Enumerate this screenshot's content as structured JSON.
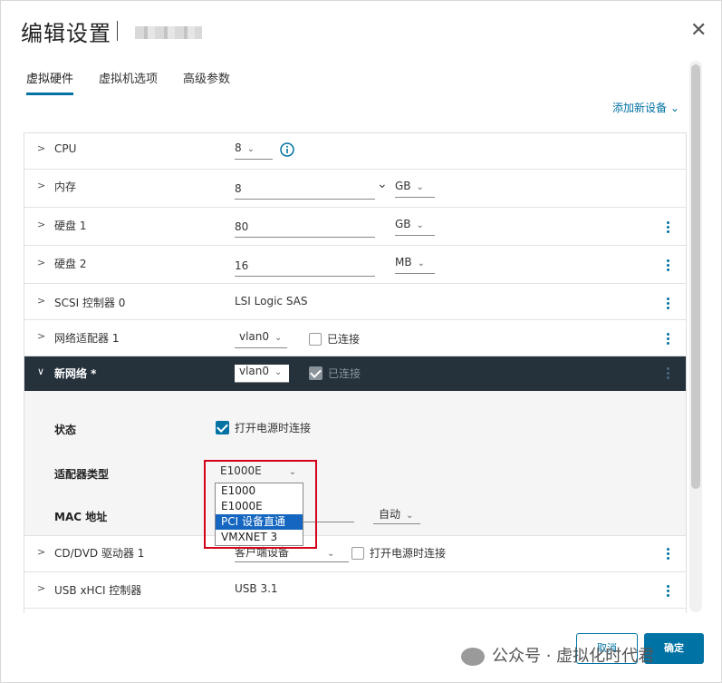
{
  "dialog": {
    "title": "编辑设置",
    "close": "✕"
  },
  "tabs": [
    "虚拟硬件",
    "虚拟机选项",
    "高级参数"
  ],
  "add_device": "添加新设备",
  "hardware": {
    "cpu": {
      "label": "CPU",
      "value": "8"
    },
    "memory": {
      "label": "内存",
      "value": "8",
      "unit": "GB"
    },
    "disk1": {
      "label": "硬盘 1",
      "value": "80",
      "unit": "GB"
    },
    "disk2": {
      "label": "硬盘 2",
      "value": "16",
      "unit": "MB"
    },
    "scsi": {
      "label": "SCSI 控制器 0",
      "value": "LSI Logic SAS"
    },
    "nic1": {
      "label": "网络适配器 1",
      "network": "vlan0",
      "connected_label": "已连接"
    },
    "new_net": {
      "label": "新网络 *",
      "network": "vlan0",
      "connected_label": "已连接"
    },
    "new_net_detail": {
      "status_label": "状态",
      "power_on_label": "打开电源时连接",
      "adapter_label": "适配器类型",
      "adapter_value": "E1000E",
      "mac_label": "MAC 地址",
      "mac_mode": "自动"
    },
    "cdrom": {
      "label": "CD/DVD 驱动器 1",
      "value": "客户端设备",
      "power_on_label": "打开电源时连接"
    },
    "usb": {
      "label": "USB xHCI 控制器",
      "value": "USB 3.1"
    }
  },
  "adapter_options": [
    "E1000",
    "E1000E",
    "PCI 设备直通",
    "VMXNET 3"
  ],
  "adapter_selected_index": 2,
  "footer": {
    "cancel": "取消",
    "ok": "确定",
    "watermark": "公众号 · 虚拟化时代君"
  },
  "colors": {
    "accent": "#0072a3",
    "dark_row": "#25313b",
    "selection": "#1566c0",
    "highlight_box": "#d4001a"
  }
}
